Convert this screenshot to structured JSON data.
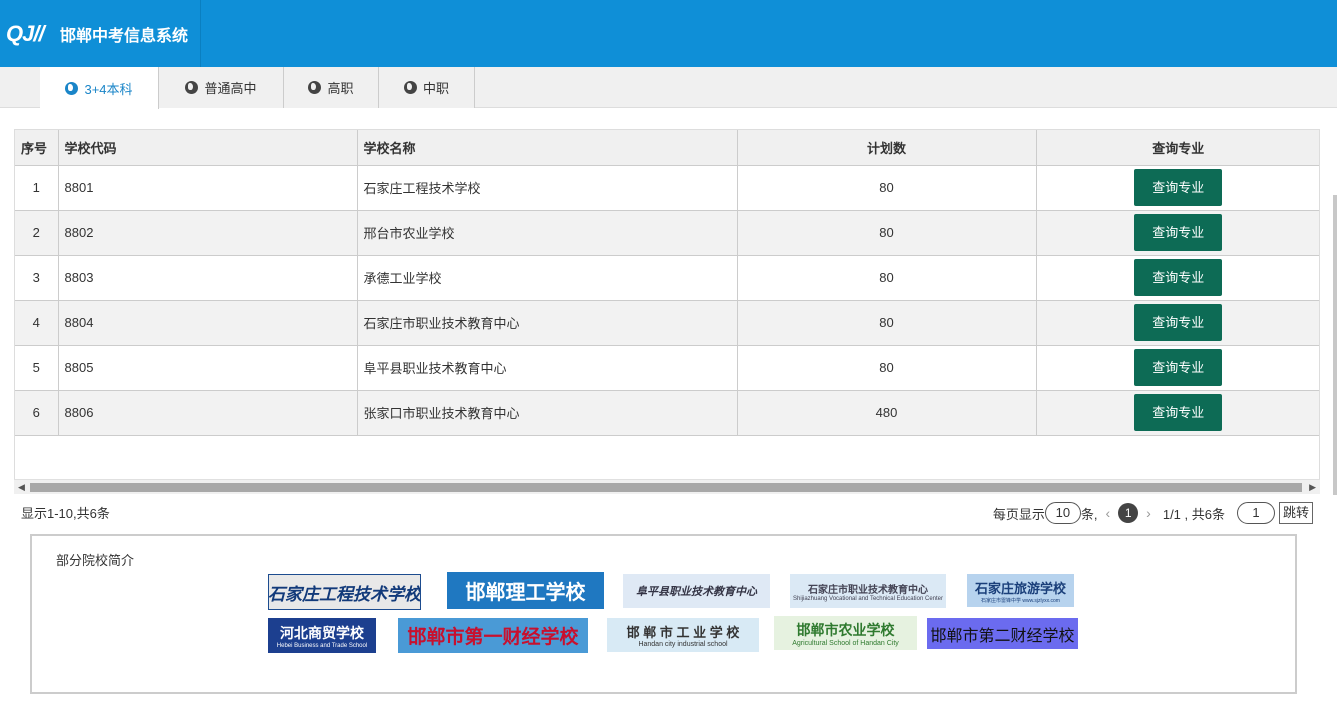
{
  "app": {
    "logo_text": "QJ//",
    "title": "邯郸中考信息系统"
  },
  "tabs": [
    {
      "label": "3+4本科",
      "active": true
    },
    {
      "label": "普通高中",
      "active": false
    },
    {
      "label": "高职",
      "active": false
    },
    {
      "label": "中职",
      "active": false
    }
  ],
  "table": {
    "headers": {
      "index": "序号",
      "code": "学校代码",
      "name": "学校名称",
      "plan": "计划数",
      "query": "查询专业"
    },
    "rows": [
      {
        "index": "1",
        "code": "8801",
        "name": "石家庄工程技术学校",
        "plan": "80",
        "action": "查询专业"
      },
      {
        "index": "2",
        "code": "8802",
        "name": "邢台市农业学校",
        "plan": "80",
        "action": "查询专业"
      },
      {
        "index": "3",
        "code": "8803",
        "name": "承德工业学校",
        "plan": "80",
        "action": "查询专业"
      },
      {
        "index": "4",
        "code": "8804",
        "name": "石家庄市职业技术教育中心",
        "plan": "80",
        "action": "查询专业"
      },
      {
        "index": "5",
        "code": "8805",
        "name": "阜平县职业技术教育中心",
        "plan": "80",
        "action": "查询专业"
      },
      {
        "index": "6",
        "code": "8806",
        "name": "张家口市职业技术教育中心",
        "plan": "480",
        "action": "查询专业"
      }
    ]
  },
  "footer": {
    "summary": "显示1-10,共6条",
    "per_page_label": "每页显示",
    "per_page_value": "10",
    "per_page_suffix": "条,",
    "current_page": "1",
    "page_info": "1/1 , 共6条",
    "jump_value": "1",
    "jump_label": "跳转"
  },
  "intro": {
    "title": "部分院校简介",
    "banners": [
      {
        "text": "石家庄工程技术学校"
      },
      {
        "text": "邯郸理工学校"
      },
      {
        "text": "阜平县职业技术教育中心"
      },
      {
        "text": "石家庄市职业技术教育中心",
        "sub": "Shijiazhuang Vocational and Technical Education Center"
      },
      {
        "text": "石家庄旅游学校",
        "sub": "石家庄市雷锋中学  www.sjzlyxx.com"
      },
      {
        "text": "河北商贸学校",
        "sub": "Hebei Business and Trade School"
      },
      {
        "text": "邯郸市第一财经学校"
      },
      {
        "text": "邯 郸 市 工 业 学 校",
        "sub": "Handan city industrial school"
      },
      {
        "text": "邯郸市农业学校",
        "sub": "Agricultural School of Handan City"
      },
      {
        "text": "邯郸市第二财经学校"
      }
    ]
  },
  "colors": {
    "header_blue": "#0f8fd7",
    "button_green": "#0d6b55",
    "active_tab": "#1a85c8"
  }
}
